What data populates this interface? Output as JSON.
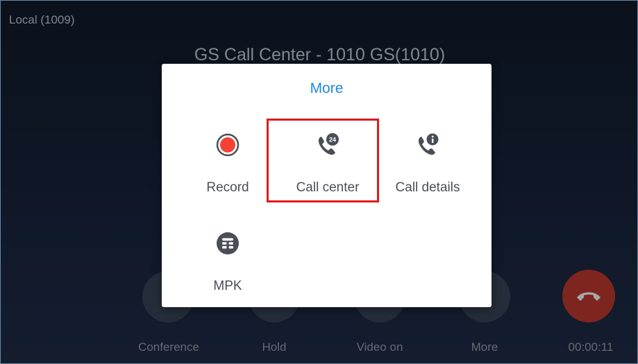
{
  "status": {
    "local_line": "Local (1009)",
    "call_title": "GS Call Center - 1010 GS(1010)"
  },
  "controls": [
    {
      "label": "Conference",
      "icon": "conference-icon"
    },
    {
      "label": "Hold",
      "icon": "hold-icon"
    },
    {
      "label": "Video on",
      "icon": "video-icon"
    },
    {
      "label": "More",
      "icon": "more-icon"
    }
  ],
  "hangup": {
    "icon": "hangup-icon",
    "color": "#c43a30"
  },
  "timer": "00:00:11",
  "dialog": {
    "title": "More",
    "title_color": "#1e88e5",
    "items": [
      {
        "label": "Record",
        "icon": "record-icon"
      },
      {
        "label": "Call center",
        "icon": "call-center-icon",
        "badge": "24",
        "highlighted": true
      },
      {
        "label": "Call details",
        "icon": "call-details-icon"
      },
      {
        "label": "MPK",
        "icon": "mpk-icon"
      }
    ]
  },
  "colors": {
    "highlight_border": "#e01a1a",
    "record_dot": "#f44336",
    "icon_dark": "#4a4f57"
  }
}
